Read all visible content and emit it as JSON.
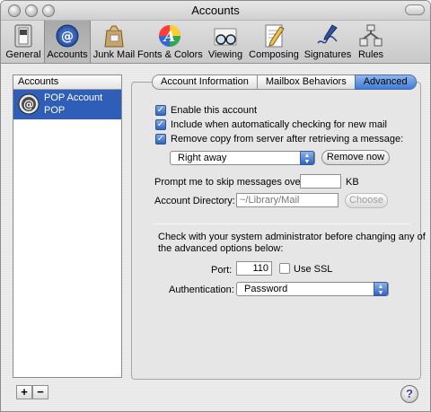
{
  "window": {
    "title": "Accounts"
  },
  "toolbar": {
    "items": [
      {
        "label": "General",
        "icon": "switch-icon"
      },
      {
        "label": "Accounts",
        "icon": "at-sign-icon"
      },
      {
        "label": "Junk Mail",
        "icon": "junk-mail-bag-icon"
      },
      {
        "label": "Fonts & Colors",
        "icon": "fonts-colors-icon"
      },
      {
        "label": "Viewing",
        "icon": "glasses-icon"
      },
      {
        "label": "Composing",
        "icon": "pencil-paper-icon"
      },
      {
        "label": "Signatures",
        "icon": "signature-pen-icon"
      },
      {
        "label": "Rules",
        "icon": "rules-icon"
      }
    ],
    "active": "Accounts"
  },
  "accounts": {
    "header": "Accounts",
    "items": [
      {
        "name": "POP Account",
        "type": "POP",
        "icon": "pop-account-icon"
      }
    ],
    "add_label": "+",
    "remove_label": "−"
  },
  "tabs": {
    "items": [
      "Account Information",
      "Mailbox Behaviors",
      "Advanced"
    ],
    "active": "Advanced"
  },
  "advanced": {
    "enable_account": {
      "label": "Enable this account",
      "checked": true
    },
    "include_auto_check": {
      "label": "Include when automatically checking for new mail",
      "checked": true
    },
    "remove_copy": {
      "label": "Remove copy from server after retrieving a message:",
      "checked": true
    },
    "remove_when": {
      "value": "Right away"
    },
    "remove_now_label": "Remove now",
    "prompt_label": "Prompt me to skip messages over",
    "prompt_value": "",
    "prompt_unit": "KB",
    "dir_label": "Account Directory:",
    "dir_value": "~/Library/Mail",
    "choose_label": "Choose",
    "admin_note_1": "Check with your system administrator before changing any of",
    "admin_note_2": "the advanced options below:",
    "port_label": "Port:",
    "port_value": "110",
    "use_ssl_label": "Use SSL",
    "use_ssl_checked": false,
    "auth_label": "Authentication:",
    "auth_value": "Password"
  },
  "help_label": "?",
  "colors": {
    "selection": "#2f5eb8",
    "accent": "#3f7bd8"
  }
}
